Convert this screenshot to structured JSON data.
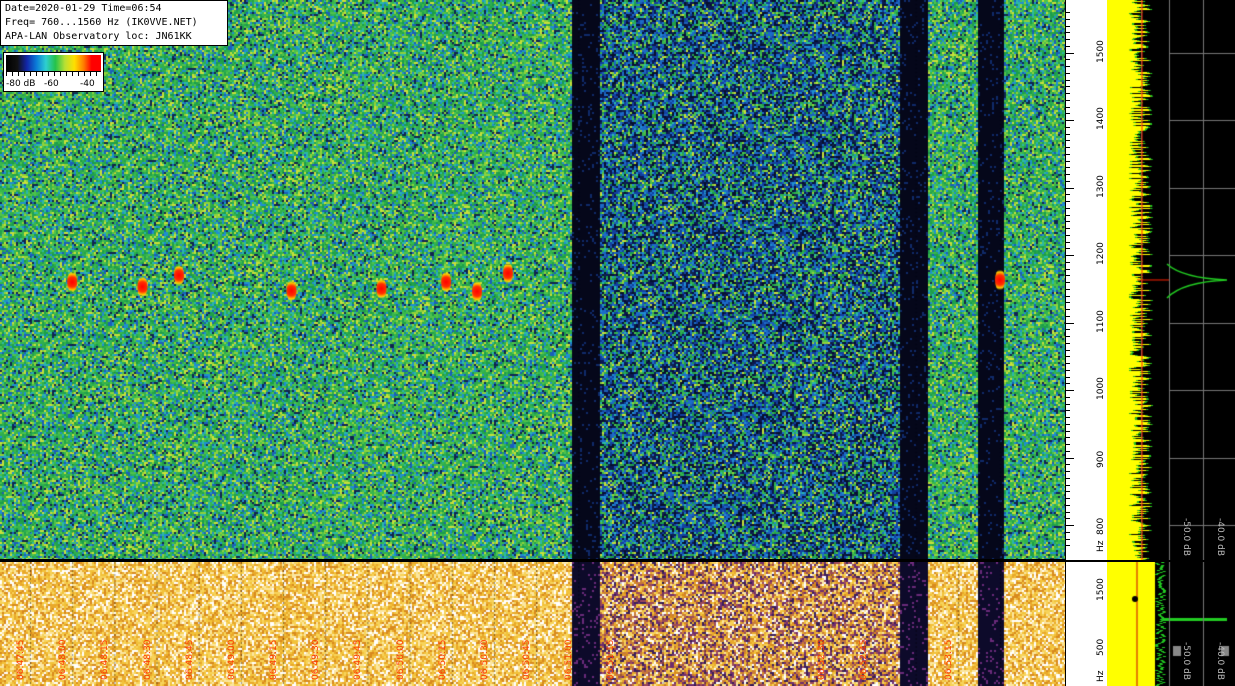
{
  "header": {
    "line1": "Date=2020-01-29 Time=06:54",
    "line2": "Freq= 760...1560 Hz (IK0VVE.NET)",
    "line3": "APA-LAN Observatory loc: JN61KK"
  },
  "colorbar": {
    "labels": [
      "-80 dB",
      "-60",
      "-40"
    ]
  },
  "colors": {
    "waterfall_background": "#2fae4e",
    "dark_band": "#07091c",
    "lower_panel": "#f2c23a",
    "spectrum_trace": "#ffff00",
    "spectrum_green": "#22cc22",
    "marker_red": "#ff2000",
    "time_label": "#ff3a00"
  },
  "chart_data": {
    "type": "heatmap",
    "title": "",
    "xlabel": "",
    "ylabel": "Hz",
    "ylim": [
      760,
      1560
    ],
    "y_ticks": [
      800,
      900,
      1000,
      1100,
      1200,
      1300,
      1400,
      1500
    ],
    "y_unit_label": "Hz",
    "x_ticks": [
      "06:47:45",
      "06:48:00",
      "06:48:15",
      "06:48:30",
      "06:48:45",
      "06:49:00",
      "06:49:15",
      "06:49:30",
      "06:49:45",
      "06:50:00",
      "06:50:15",
      "06:50:30",
      "06:50:45",
      "06:51:00",
      "06:51:15",
      "06:51:30",
      "06:51:45",
      "06:52:00",
      "06:52:15",
      "06:52:30",
      "06:52:45",
      "06:53:00",
      "06:53:15",
      "06:53:30"
    ],
    "x_tick_labels_visible": [
      "06:47:45",
      "06:48:00",
      "06:48:15",
      "06:48:30",
      "06:48:45",
      "06:49:00",
      "06:49:15",
      "06:49:30",
      "06:49:45",
      "06:50:00",
      "06:50:15",
      "06:50:30",
      "06:50:45",
      "06:51:00",
      "06:51:15",
      "06:52:30",
      "06:52:45",
      "06:53:15"
    ],
    "dark_bands": [
      [
        "06:51:00",
        "06:51:05"
      ],
      [
        "06:52:57",
        "06:53:01"
      ],
      [
        "06:53:25",
        "06:53:28"
      ]
    ],
    "spectrum_db_labels": [
      "-50.0 dB",
      "-40.0 dB"
    ],
    "lower_panel": {
      "y_ticks": [
        500,
        1500
      ],
      "y_unit_label": "Hz",
      "db_labels": [
        "-50.0 dB",
        "-40.0 dB"
      ]
    },
    "signals": [
      {
        "time": "06:48:00",
        "freq": 1160
      },
      {
        "time": "06:48:25",
        "freq": 1153
      },
      {
        "time": "06:48:38",
        "freq": 1170
      },
      {
        "time": "06:49:18",
        "freq": 1147
      },
      {
        "time": "06:49:50",
        "freq": 1150
      },
      {
        "time": "06:50:13",
        "freq": 1160
      },
      {
        "time": "06:50:24",
        "freq": 1146
      },
      {
        "time": "06:50:35",
        "freq": 1173
      },
      {
        "time": "06:53:30",
        "freq": 1163
      }
    ]
  }
}
